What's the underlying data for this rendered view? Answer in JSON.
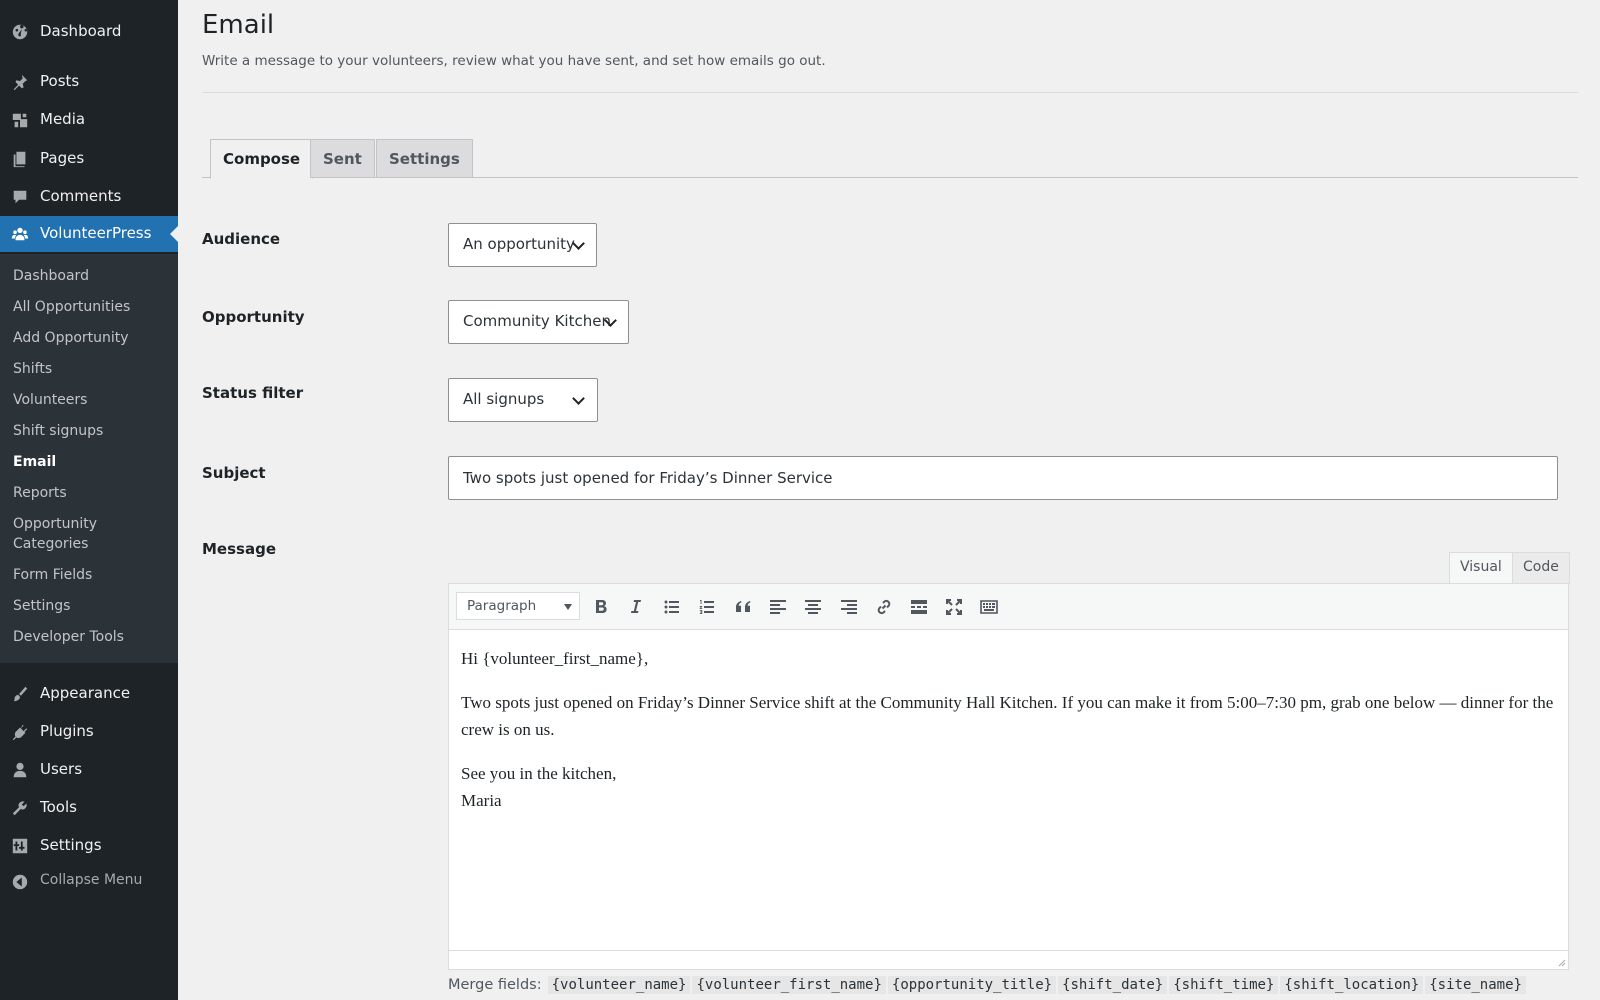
{
  "sidebar": {
    "top_items": [
      {
        "label": "Dashboard",
        "icon": "dashboard-icon"
      },
      {
        "label": "Posts",
        "icon": "pin-icon"
      },
      {
        "label": "Media",
        "icon": "media-icon"
      },
      {
        "label": "Pages",
        "icon": "pages-icon"
      },
      {
        "label": "Comments",
        "icon": "comment-icon"
      },
      {
        "label": "VolunteerPress",
        "icon": "groups-icon",
        "active": true
      }
    ],
    "submenu": [
      {
        "label": "Dashboard"
      },
      {
        "label": "All Opportunities"
      },
      {
        "label": "Add Opportunity"
      },
      {
        "label": "Shifts"
      },
      {
        "label": "Volunteers"
      },
      {
        "label": "Shift signups"
      },
      {
        "label": "Email",
        "current": true
      },
      {
        "label": "Reports"
      },
      {
        "label": "Opportunity Categories"
      },
      {
        "label": "Form Fields"
      },
      {
        "label": "Settings"
      },
      {
        "label": "Developer Tools"
      }
    ],
    "bottom_items": [
      {
        "label": "Appearance",
        "icon": "brush-icon"
      },
      {
        "label": "Plugins",
        "icon": "plugin-icon"
      },
      {
        "label": "Users",
        "icon": "user-icon"
      },
      {
        "label": "Tools",
        "icon": "wrench-icon"
      },
      {
        "label": "Settings",
        "icon": "settings-icon"
      },
      {
        "label": "Collapse Menu",
        "icon": "collapse-icon"
      }
    ],
    "colors": {
      "bg": "#1d2327",
      "submenu_bg": "#2c3338",
      "active": "#2271b1"
    }
  },
  "page": {
    "title": "Email",
    "description": "Write a message to your volunteers, review what you have sent, and set how emails go out."
  },
  "tabs": [
    {
      "label": "Compose",
      "active": true
    },
    {
      "label": "Sent"
    },
    {
      "label": "Settings"
    }
  ],
  "form": {
    "audience": {
      "label": "Audience",
      "value": "An opportunity"
    },
    "opportunity": {
      "label": "Opportunity",
      "value": "Community Kitchen"
    },
    "status_filter": {
      "label": "Status filter",
      "value": "All signups"
    },
    "subject": {
      "label": "Subject",
      "value": "Two spots just opened for Friday’s Dinner Service"
    },
    "message": {
      "label": "Message"
    }
  },
  "editor": {
    "mode_tabs": {
      "visual": "Visual",
      "code": "Code"
    },
    "format_select": "Paragraph",
    "toolbar_icons": [
      "bold-icon",
      "italic-icon",
      "bullet-list-icon",
      "numbered-list-icon",
      "blockquote-icon",
      "align-left-icon",
      "align-center-icon",
      "align-right-icon",
      "link-icon",
      "read-more-icon",
      "fullscreen-icon",
      "toolbar-toggle-icon"
    ],
    "content": {
      "greeting": "Hi {volunteer_first_name},",
      "body": "Two spots just opened on Friday’s Dinner Service shift at the Community Hall Kitchen. If you can make it from 5:00–7:30 pm, grab one below — dinner for the crew is on us.",
      "closing": "See you in the kitchen,",
      "signature": "Maria"
    }
  },
  "merge_fields": {
    "label": "Merge fields:",
    "fields": [
      "{volunteer_name}",
      "{volunteer_first_name}",
      "{opportunity_title}",
      "{shift_date}",
      "{shift_time}",
      "{shift_location}",
      "{site_name}"
    ]
  }
}
